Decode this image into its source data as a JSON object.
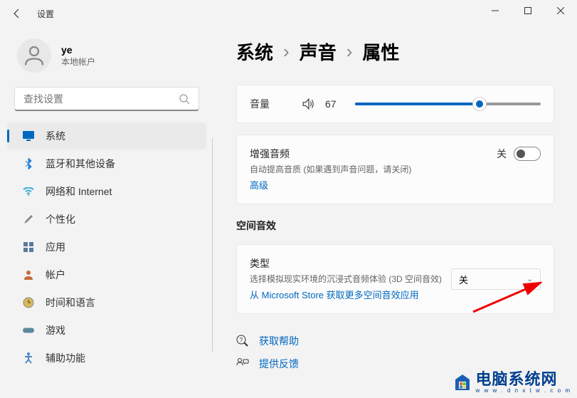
{
  "app_title": "设置",
  "user": {
    "name": "ye",
    "subtitle": "本地帐户"
  },
  "search": {
    "placeholder": "查找设置"
  },
  "sidebar": {
    "items": [
      {
        "label": "系统",
        "active": true,
        "icon": "system"
      },
      {
        "label": "蓝牙和其他设备",
        "icon": "bluetooth"
      },
      {
        "label": "网络和 Internet",
        "icon": "network"
      },
      {
        "label": "个性化",
        "icon": "personalize"
      },
      {
        "label": "应用",
        "icon": "apps"
      },
      {
        "label": "帐户",
        "icon": "accounts"
      },
      {
        "label": "时间和语言",
        "icon": "time"
      },
      {
        "label": "游戏",
        "icon": "gaming"
      },
      {
        "label": "辅助功能",
        "icon": "accessibility"
      }
    ]
  },
  "breadcrumb": {
    "level1": "系统",
    "level2": "声音",
    "level3": "属性"
  },
  "volume": {
    "label": "音量",
    "value": "67",
    "percent": 67
  },
  "enhance": {
    "title": "增强音频",
    "subtitle": "自动提高音质 (如果遇到声音问题，请关闭)",
    "advanced": "高级",
    "state": "关"
  },
  "spatial": {
    "heading": "空间音效",
    "type_label": "类型",
    "type_sub": "选择模拟现实环境的沉浸式音频体验 (3D 空间音效)",
    "store_link": "从 Microsoft Store 获取更多空间音效应用",
    "selected": "关"
  },
  "help": {
    "get_help": "获取帮助",
    "feedback": "提供反馈"
  },
  "watermark": {
    "text": "电脑系统网",
    "url": "w w w . d n x t w . c o m"
  }
}
